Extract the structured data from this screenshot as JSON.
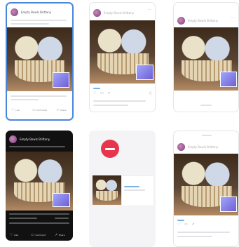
{
  "profile": {
    "name": "Empty Bowls Brittany"
  },
  "actions": {
    "like": "Like",
    "comment": "Comment",
    "share": "Share"
  },
  "icons": {
    "more": "more-dots-icon",
    "like": "like-icon",
    "comment": "comment-icon",
    "share": "share-icon",
    "bookmark": "bookmark-icon",
    "blocked": "blocked-icon"
  },
  "colors": {
    "selected_border": "#4a86d8",
    "accent": "#7cb2ea",
    "blocked": "#e8354e",
    "dark_bg": "#111111"
  }
}
